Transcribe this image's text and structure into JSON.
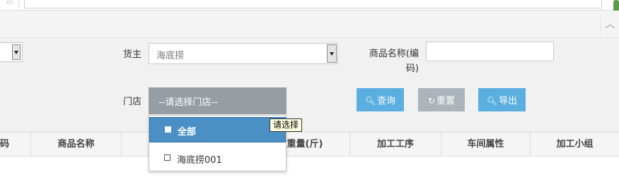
{
  "browser": {
    "home_icon": "page-icon",
    "scroll_icon": "chevron-up-icon"
  },
  "form": {
    "owner_label": "货主",
    "owner_value": "海底捞",
    "product_label": "商品名称(编码)",
    "product_value": "",
    "store_label": "门店",
    "store_value": "--请选择门店--"
  },
  "buttons": {
    "query": "查询",
    "reset": "重置",
    "export": "导出"
  },
  "dropdown": {
    "options": [
      {
        "label": "全部",
        "checked": false,
        "highlighted": true
      },
      {
        "label": "海底捞001",
        "checked": false,
        "highlighted": false
      }
    ]
  },
  "tooltip": "请选择",
  "table": {
    "columns": [
      "码",
      "商品名称",
      "",
      "重量(斤)",
      "加工工序",
      "车间属性",
      "加工小组"
    ]
  },
  "colors": {
    "primary_button": "#5aaee0",
    "reset_button": "#aab4ba",
    "select_active": "#969ea4",
    "option_highlight": "#4a90c4"
  }
}
